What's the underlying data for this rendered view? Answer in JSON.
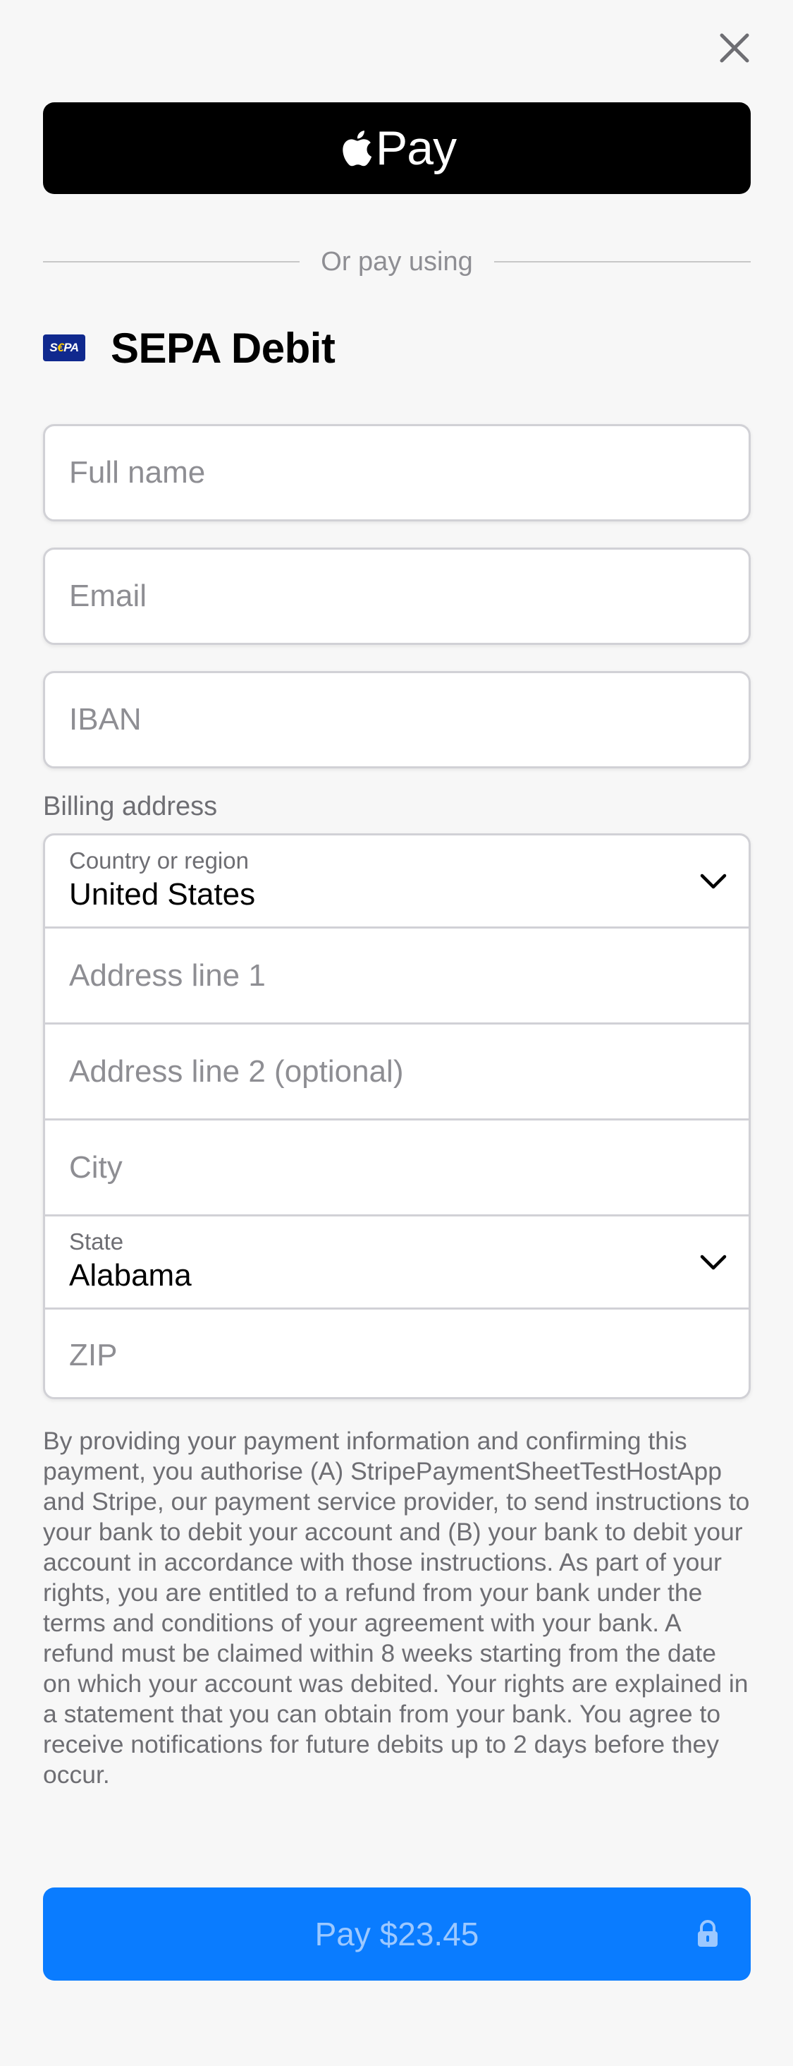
{
  "header": {
    "close_icon": "close-icon"
  },
  "apple_pay": {
    "label": "Pay",
    "icon": "apple-logo-icon"
  },
  "divider": {
    "text": "Or pay using"
  },
  "payment_method": {
    "logo_text": "SEPA",
    "title": "SEPA Debit",
    "icon": "sepa-logo-icon"
  },
  "fields": {
    "full_name_placeholder": "Full name",
    "email_placeholder": "Email",
    "iban_placeholder": "IBAN"
  },
  "billing": {
    "section_label": "Billing address",
    "country_label": "Country or region",
    "country_value": "United States",
    "address1_placeholder": "Address line 1",
    "address2_placeholder": "Address line 2 (optional)",
    "city_placeholder": "City",
    "state_label": "State",
    "state_value": "Alabama",
    "zip_placeholder": "ZIP"
  },
  "legal_text": "By providing your payment information and confirming this payment, you authorise (A) StripePaymentSheetTestHostApp and Stripe, our payment service provider, to send instructions to your bank to debit your account and (B) your bank to debit your account in accordance with those instructions. As part of your rights, you are entitled to a refund from your bank under the terms and conditions of your agreement with your bank. A refund must be claimed within 8 weeks starting from the date on which your account was debited. Your rights are explained in a statement that you can obtain from your bank. You agree to receive notifications for future debits up to 2 days before they occur.",
  "pay_button": {
    "label": "Pay $23.45",
    "icon": "lock-icon"
  },
  "colors": {
    "accent": "#0a7cff",
    "border": "#d1d1d6",
    "muted_text": "#6e6e73",
    "placeholder": "#8e8e93"
  }
}
